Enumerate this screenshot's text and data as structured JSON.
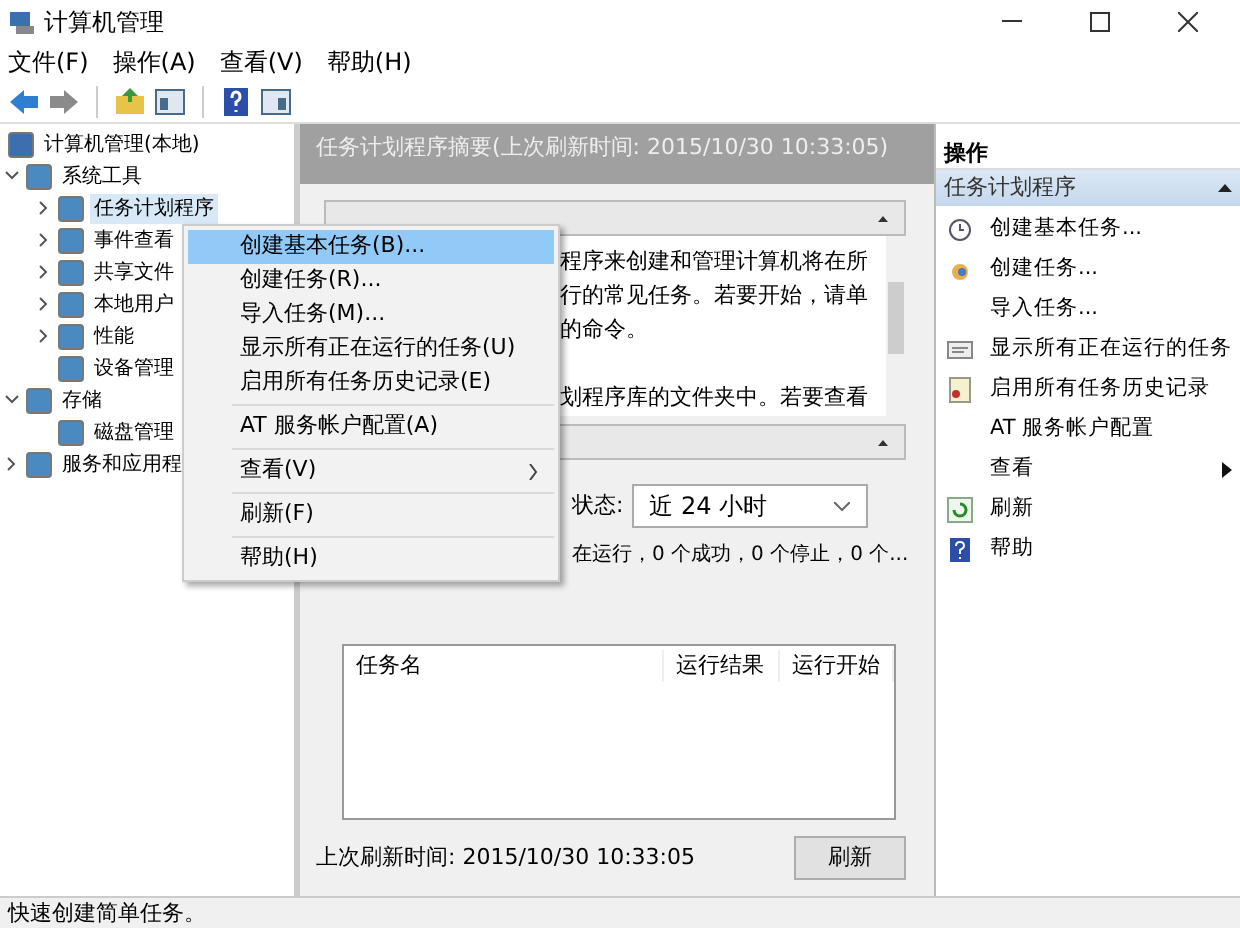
{
  "window": {
    "title": "计算机管理"
  },
  "menu_bar": [
    "文件(F)",
    "操作(A)",
    "查看(V)",
    "帮助(H)"
  ],
  "tree": [
    {
      "label": "计算机管理(本地)",
      "children": [
        {
          "label": "系统工具",
          "expanded": true,
          "children": [
            {
              "label": "任务计划程序",
              "selected": true,
              "expandable": true
            },
            {
              "label": "事件查看",
              "selected": false,
              "expandable": true
            },
            {
              "label": "共享文件",
              "selected": false,
              "expandable": true
            },
            {
              "label": "本地用户",
              "selected": false,
              "expandable": true
            },
            {
              "label": "性能",
              "selected": false,
              "expandable": true
            },
            {
              "label": "设备管理",
              "selected": false,
              "expandable": false
            }
          ]
        },
        {
          "label": "存储",
          "expanded": true,
          "children": [
            {
              "label": "磁盘管理",
              "selected": false,
              "expandable": false
            }
          ]
        },
        {
          "label": "服务和应用程",
          "expanded": false
        }
      ]
    }
  ],
  "summary": {
    "title": "任务计划程序摘要(上次刷新时间: 2015/10/30 10:33:05)",
    "overview_paragraphs": [
      [
        "程序来创建和管理计算机将在所",
        "行的常见任务。若要开始，请单",
        "的命令。"
      ],
      [
        "划程序库的文件夹中。若要查看"
      ]
    ],
    "status_label": "状态:",
    "status_dropdown": "近 24 小时",
    "status_line": "在运行，0 个成功，0 个停止，0 个...",
    "table_columns": [
      "任务名",
      "运行结果",
      "运行开始"
    ],
    "last_refresh": "上次刷新时间: 2015/10/30 10:33:05",
    "refresh_button": "刷新"
  },
  "context_menu": [
    {
      "label": "创建基本任务(B)...",
      "selected": true,
      "kind": "item"
    },
    {
      "label": "创建任务(R)...",
      "selected": false,
      "kind": "item"
    },
    {
      "label": "导入任务(M)...",
      "selected": false,
      "kind": "item"
    },
    {
      "label": "显示所有正在运行的任务(U)",
      "selected": false,
      "kind": "item"
    },
    {
      "label": "启用所有任务历史记录(E)",
      "selected": false,
      "kind": "item"
    },
    {
      "kind": "separator"
    },
    {
      "label": "AT 服务帐户配置(A)",
      "selected": false,
      "kind": "item"
    },
    {
      "kind": "separator"
    },
    {
      "label": "查看(V)",
      "selected": false,
      "kind": "submenu"
    },
    {
      "kind": "separator"
    },
    {
      "label": "刷新(F)",
      "selected": false,
      "kind": "item"
    },
    {
      "kind": "separator"
    },
    {
      "label": "帮助(H)",
      "selected": false,
      "kind": "item"
    }
  ],
  "actions": {
    "title": "操作",
    "section": "任务计划程序",
    "items": [
      {
        "label": "创建基本任务...",
        "kind": "clock"
      },
      {
        "label": "创建任务...",
        "kind": "task"
      },
      {
        "label": "导入任务...",
        "kind": "none"
      },
      {
        "label": "显示所有正在运行的任务",
        "kind": "list"
      },
      {
        "label": "启用所有任务历史记录",
        "kind": "history"
      },
      {
        "label": "AT 服务帐户配置",
        "kind": "none"
      },
      {
        "label": "查看",
        "kind": "submenu"
      },
      {
        "label": "刷新",
        "kind": "refresh"
      },
      {
        "label": "帮助",
        "kind": "help"
      }
    ]
  },
  "status_bar": "快速创建简单任务。"
}
